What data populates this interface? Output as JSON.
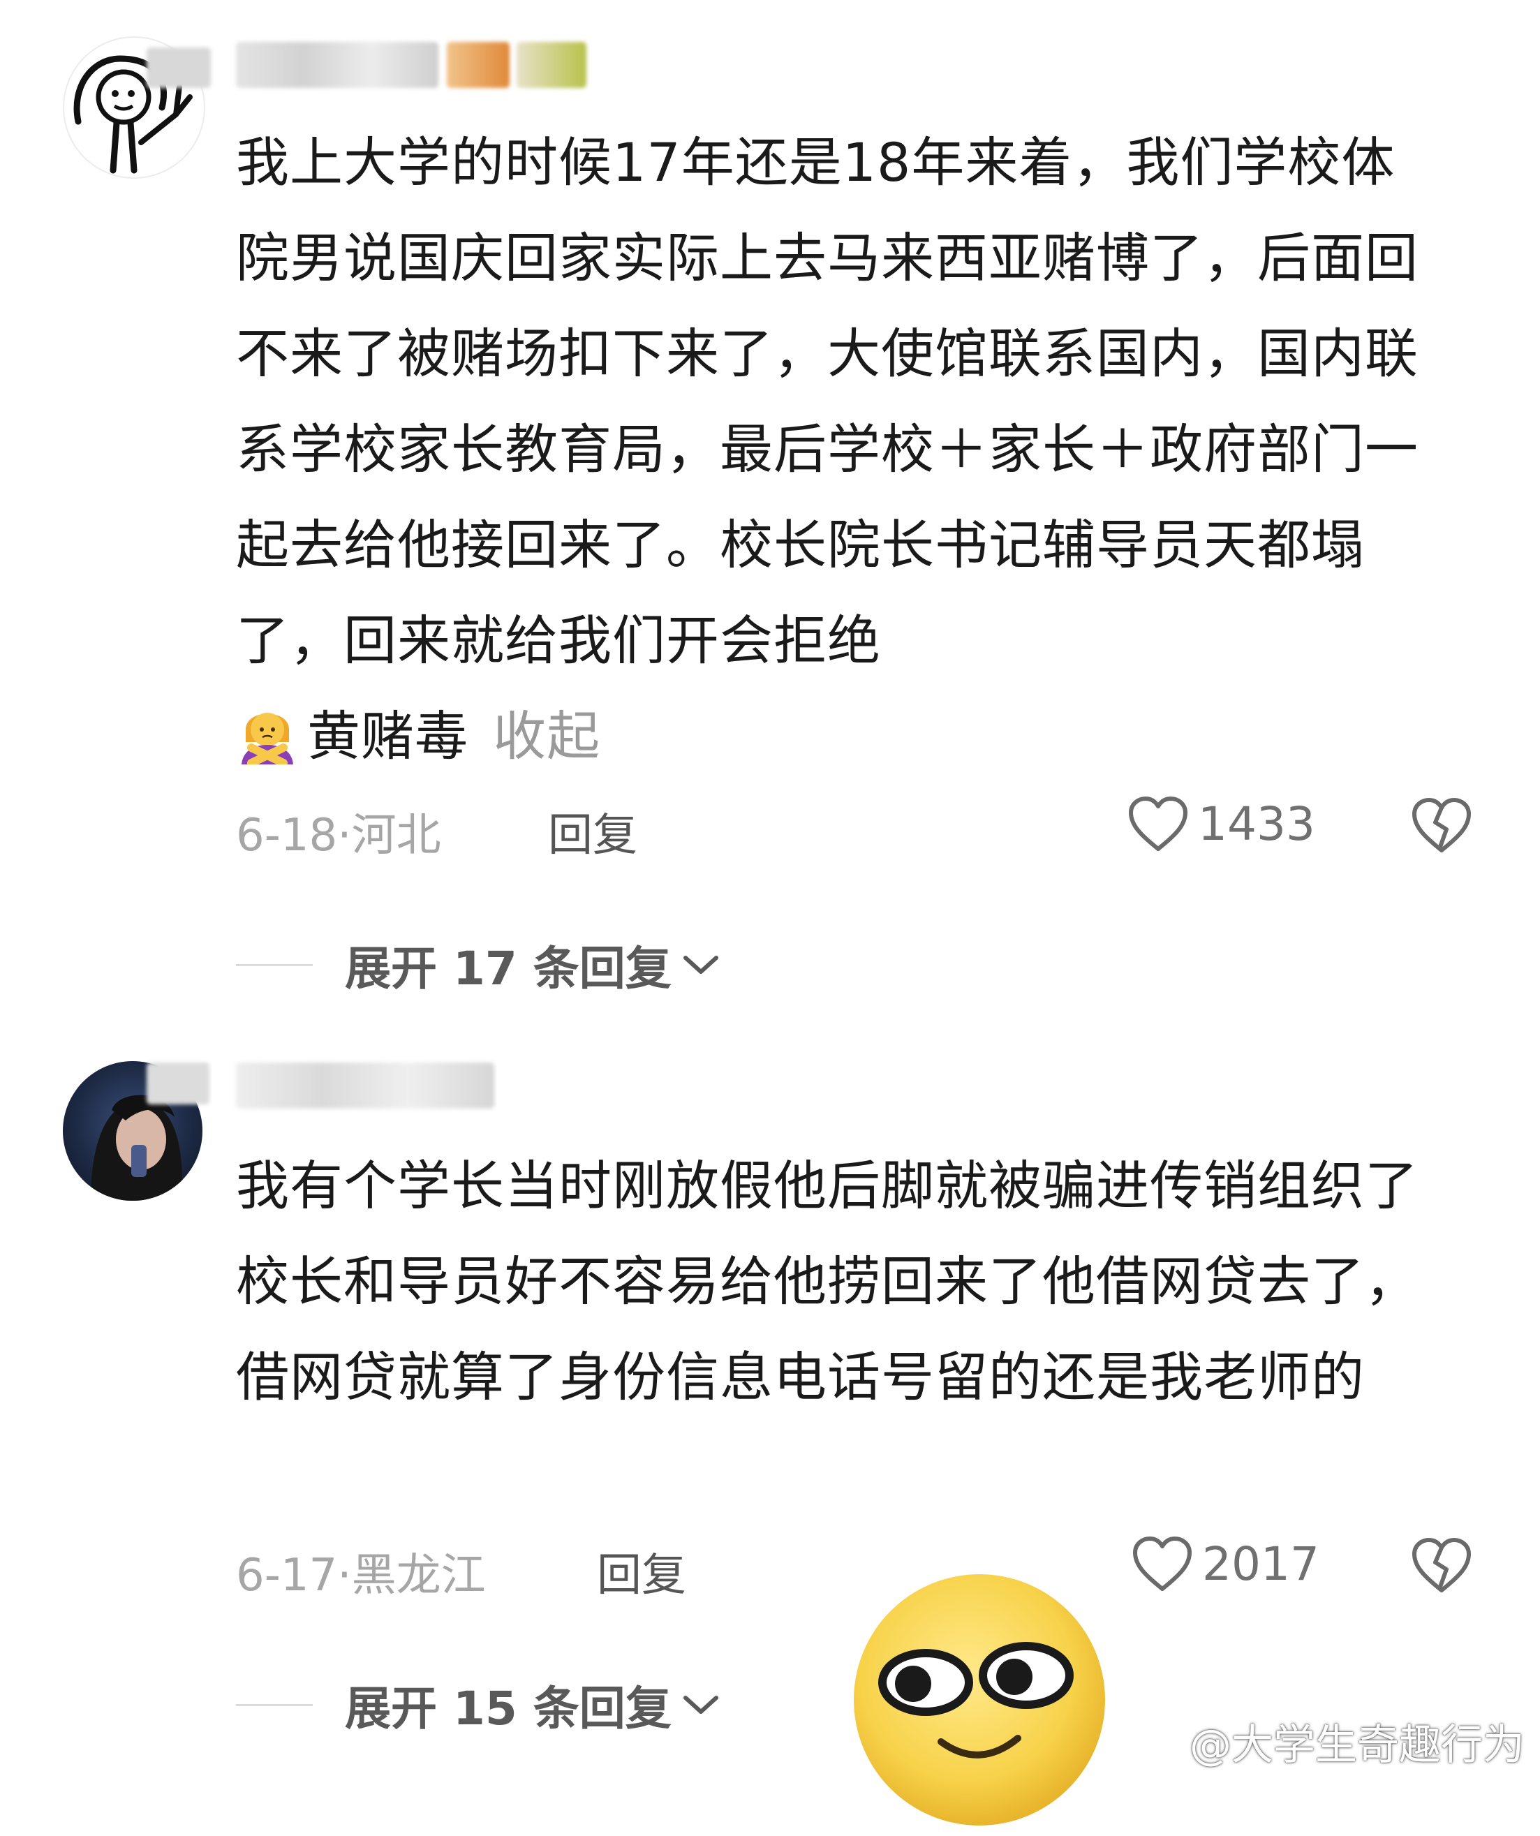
{
  "comments": [
    {
      "text": "我上大学的时候17年还是18年来着，我们学校体院男说国庆回家实际上去马来西亚赌博了，后面回不来了被赌场扣下来了，大使馆联系国内，国内联系学校家长教育局，最后学校＋家长＋政府部门一起去给他接回来了。校长院长书记辅导员天都塌了，回来就给我们开会拒绝",
      "text_tail": "黄赌毒",
      "emoji": "person-gesturing-no-emoji",
      "collapse_label": "收起",
      "date": "6-18",
      "location": "河北",
      "reply_label": "回复",
      "likes": "1433",
      "expand_label": "展开 17 条回复"
    },
    {
      "text": "我有个学长当时刚放假他后脚就被骗进传销组织了校长和导员好不容易给他捞回来了他借网贷去了，借网贷就算了身份信息电话号留的还是我老师的",
      "date": "6-17",
      "location": "黑龙江",
      "reply_label": "回复",
      "likes": "2017",
      "expand_label": "展开 15 条回复"
    }
  ],
  "watermark": "@大学生奇趣行为",
  "icons": {
    "like": "heart-outline-icon",
    "dislike": "broken-heart-icon",
    "expand": "chevron-down-icon",
    "watermark": "weibo-logo-icon",
    "sticker": "smirk-emoji-sticker"
  },
  "colors": {
    "text": "#1a1a1a",
    "meta": "#a6a6a6",
    "collapse": "#9a9a9a",
    "emoji_yellow": "#f7d24a"
  }
}
